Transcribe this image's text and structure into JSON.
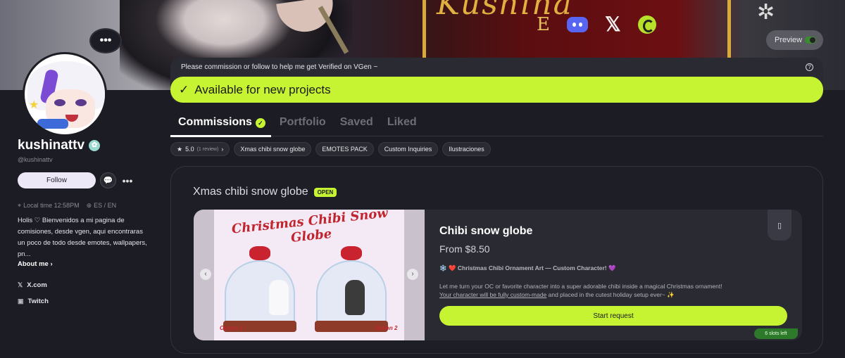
{
  "banner": {
    "title": "Kushina",
    "social_letter": "E",
    "icons": [
      "discord-icon",
      "x-icon",
      "swirl-icon"
    ]
  },
  "preview": {
    "label": "Preview",
    "enabled": true
  },
  "profile": {
    "dots": "•••",
    "username": "kushinattv",
    "handle": "@kushinattv",
    "follow_label": "Follow",
    "more": "•••",
    "local_time": "Local time 12:58PM",
    "languages": "ES / EN",
    "bio": "Holis ♡ Bienvenidos a mi pagina de comisiones, desde vgen, aqui encontraras un poco de todo desde emotes, wallpapers, pn...",
    "about_label": "About me",
    "links": [
      {
        "label": "X.com",
        "icon": "x-icon"
      },
      {
        "label": "Twitch",
        "icon": "twitch-icon"
      }
    ]
  },
  "notice": {
    "message": "Please commission or follow to help me get Verified on VGen ~",
    "availability": "Available for new projects"
  },
  "tabs": [
    {
      "label": "Commissions",
      "active": true
    },
    {
      "label": "Portfolio",
      "active": false
    },
    {
      "label": "Saved",
      "active": false
    },
    {
      "label": "Liked",
      "active": false
    }
  ],
  "chips": {
    "rating": "5.0",
    "reviews": "(1 review)",
    "items": [
      "Xmas chibi snow globe",
      "EMOTES PACK",
      "Custom Inquiries",
      "Ilustraciones"
    ]
  },
  "section": {
    "title": "Xmas chibi snow globe",
    "badge": "OPEN"
  },
  "product": {
    "art_title": "Christmas Chibi Snow Globe",
    "option1": "Option 1",
    "option2": "Option 2",
    "name": "Chibi snow globe",
    "price": "From $8.50",
    "subtitle": "❄️ ❤️ Christmas Chibi Ornament Art — Custom Character! 💜",
    "desc_line1": "Let me turn your OC or favorite character into a super adorable chibi inside a magical Christmas ornament!",
    "desc_underlined": "Your character will be fully custom-made",
    "desc_rest": " and placed in the cutest holiday setup ever~ ✨",
    "start_label": "Start request",
    "slots": "6 slots left"
  },
  "colors": {
    "accent": "#c6f432",
    "background": "#1c1c24",
    "panel": "#2a2a33"
  }
}
